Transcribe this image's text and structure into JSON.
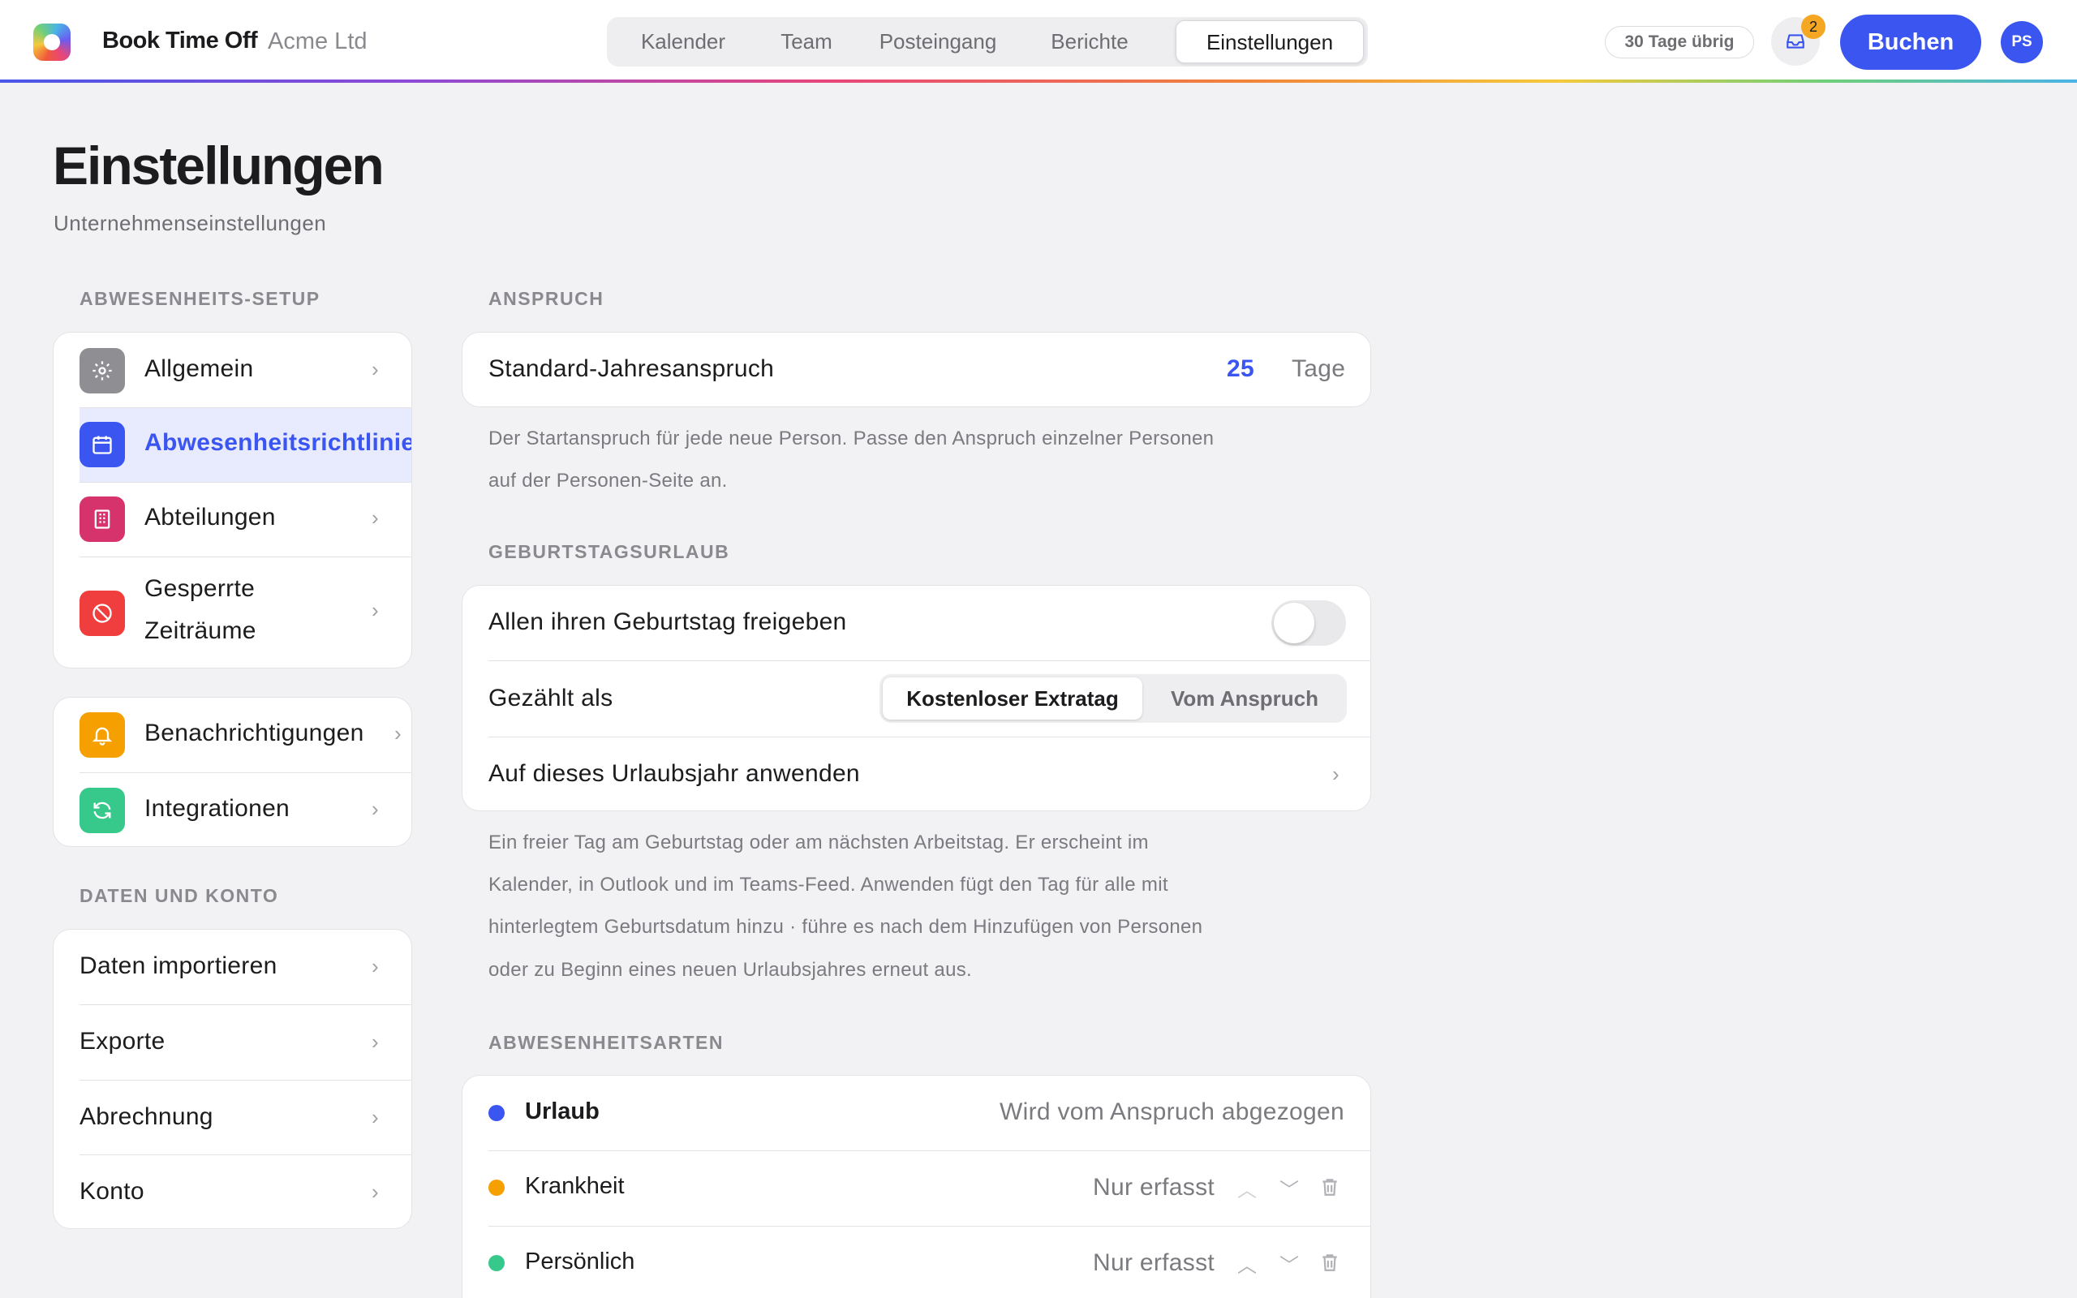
{
  "app": {
    "brand": "Book Time Off",
    "company": "Acme Ltd",
    "days_left": "30 Tage übrig",
    "inbox_count": "2",
    "book_label": "Buchen",
    "avatar_initials": "PS"
  },
  "nav_tabs": [
    {
      "label": "Kalender"
    },
    {
      "label": "Team"
    },
    {
      "label": "Posteingang"
    },
    {
      "label": "Berichte"
    },
    {
      "label": "Einstellungen",
      "active": true
    }
  ],
  "page": {
    "title": "Einstellungen",
    "subtitle": "Unternehmenseinstellungen"
  },
  "sidebar": {
    "section1_label": "ABWESENHEITS-SETUP",
    "group1": [
      {
        "label": "Allgemein",
        "icon": "gear-icon",
        "color": "#8e8e93"
      },
      {
        "label": "Abwesenheitsrichtlinie",
        "icon": "calendar-icon",
        "color": "#3a55f0",
        "active": true
      },
      {
        "label": "Abteilungen",
        "icon": "building-icon",
        "color": "#d6336c"
      },
      {
        "label": "Gesperrte",
        "label2": "Zeiträume",
        "icon": "blocked-icon",
        "color": "#f03e3e"
      }
    ],
    "group2": [
      {
        "label": "Benachrichtigungen",
        "icon": "bell-icon",
        "color": "#f59f00"
      },
      {
        "label": "Integrationen",
        "icon": "sync-icon",
        "color": "#37c98b"
      }
    ],
    "section2_label": "DATEN UND KONTO",
    "group3": [
      {
        "label": "Daten importieren"
      },
      {
        "label": "Exporte"
      },
      {
        "label": "Abrechnung"
      },
      {
        "label": "Konto"
      }
    ]
  },
  "entitlement": {
    "section_label": "ANSPRUCH",
    "row_label": "Standard-Jahresanspruch",
    "value": "25",
    "unit": "Tage",
    "help_line1": "Der Startanspruch für jede neue Person. Passe den Anspruch einzelner Personen",
    "help_line2": "auf der Personen-Seite an."
  },
  "birthday": {
    "section_label": "GEBURTSTAGSURLAUB",
    "toggle_label": "Allen ihren Geburtstag freigeben",
    "toggle_on": false,
    "counted_label": "Gezählt als",
    "seg_option1": "Kostenloser Extratag",
    "seg_option2": "Vom Anspruch",
    "seg_selected": "Kostenloser Extratag",
    "apply_label": "Auf dieses Urlaubsjahr anwenden",
    "help_line1": "Ein freier Tag am Geburtstag oder am nächsten Arbeitstag. Er erscheint im",
    "help_line2": "Kalender, in Outlook und im Teams-Feed. Anwenden fügt den Tag für alle mit",
    "help_line3": "hinterlegtem Geburtsdatum hinzu · führe es nach dem Hinzufügen von Personen",
    "help_line4": "oder zu Beginn eines neuen Urlaubsjahres erneut aus."
  },
  "absence_types": {
    "section_label": "ABWESENHEITSARTEN",
    "items": [
      {
        "name": "Urlaub",
        "mode": "Wird vom Anspruch abgezogen",
        "color": "#3a55f0"
      },
      {
        "name": "Krankheit",
        "mode": "Nur erfasst",
        "color": "#f59f00"
      },
      {
        "name": "Persönlich",
        "mode": "Nur erfasst",
        "color": "#37c98b"
      }
    ]
  },
  "colors": {
    "accent": "#3a55f0",
    "active_bg": "#e8ebfd"
  }
}
